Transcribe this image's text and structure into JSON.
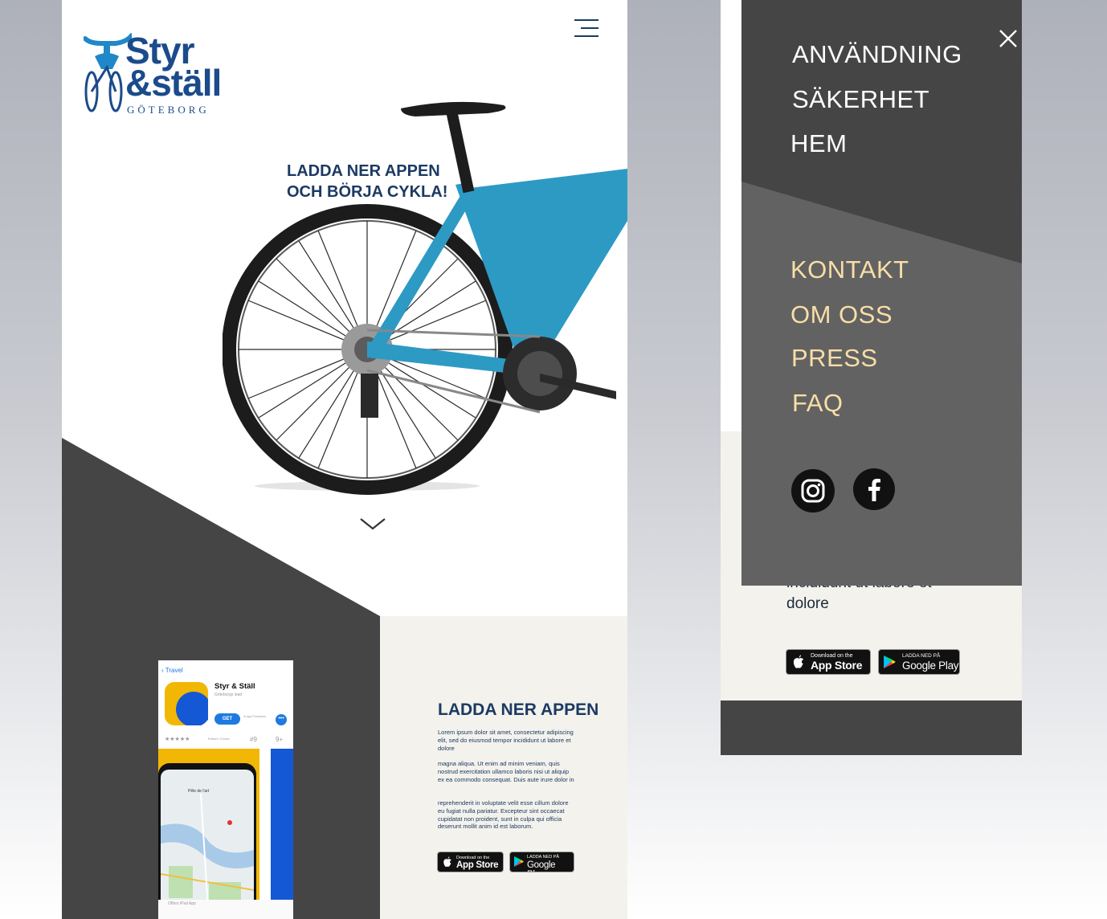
{
  "hero": {
    "logo_line1": "Styr",
    "logo_line2": "&ställ",
    "logo_city": "GÖTEBORG",
    "tagline_line1": "LADDA NER APPEN",
    "tagline_line2": "OCH BÖRJA CYKLA!"
  },
  "phone_screenshot": {
    "back_label": "Travel",
    "app_name": "Styr & Ställ",
    "app_subtitle": "Göteborgs stad",
    "get_label": "GET",
    "iap_label": "In-App Purchases",
    "stars": "★★★★★",
    "editors_choice": "Editors' Choice",
    "rank": "#9",
    "age": "9+",
    "map_place": "Pêle de l'art",
    "ipad_label": "Offers iPad App"
  },
  "app_section": {
    "heading": "LADDA NER APPEN",
    "paragraphs": [
      "Lorem ipsum dolor sit amet, consectetur adipiscing elit, sed do eiusmod tempor incididunt ut labore et dolore",
      "magna aliqua. Ut enim ad minim veniam, quis nostrud exercitation ullamco laboris nisi ut aliquip ex ea commodo consequat. Duis aute irure dolor in",
      "reprehenderit in voluptate velit esse cillum dolore eu fugiat nulla pariatur. Excepteur sint occaecat cupidatat non proident, sunt in culpa qui officia deserunt mollit anim id est laborum."
    ]
  },
  "stores": {
    "appstore_small": "Download on the",
    "appstore_large": "App Store",
    "googleplay_small": "LADDA NED PÅ",
    "googleplay_large": "Google Play"
  },
  "menu": {
    "primary": [
      "ANVÄNDNING",
      "SÄKERHET",
      "HEM"
    ],
    "secondary": [
      "KONTAKT",
      "OM OSS",
      "PRESS",
      "FAQ"
    ]
  },
  "right_body": {
    "text": "incididunt ut labore et dolore"
  },
  "colors": {
    "navy": "#1b3a63",
    "dark_gray": "#454545",
    "menu_gray": "#636263",
    "cream": "#f3f2ec",
    "gold": "#f7dfa6",
    "bike_blue": "#2d9ac4"
  },
  "icons": [
    "hamburger-icon",
    "chevron-down-icon",
    "close-icon",
    "instagram-icon",
    "facebook-icon",
    "apple-icon",
    "google-play-icon"
  ]
}
